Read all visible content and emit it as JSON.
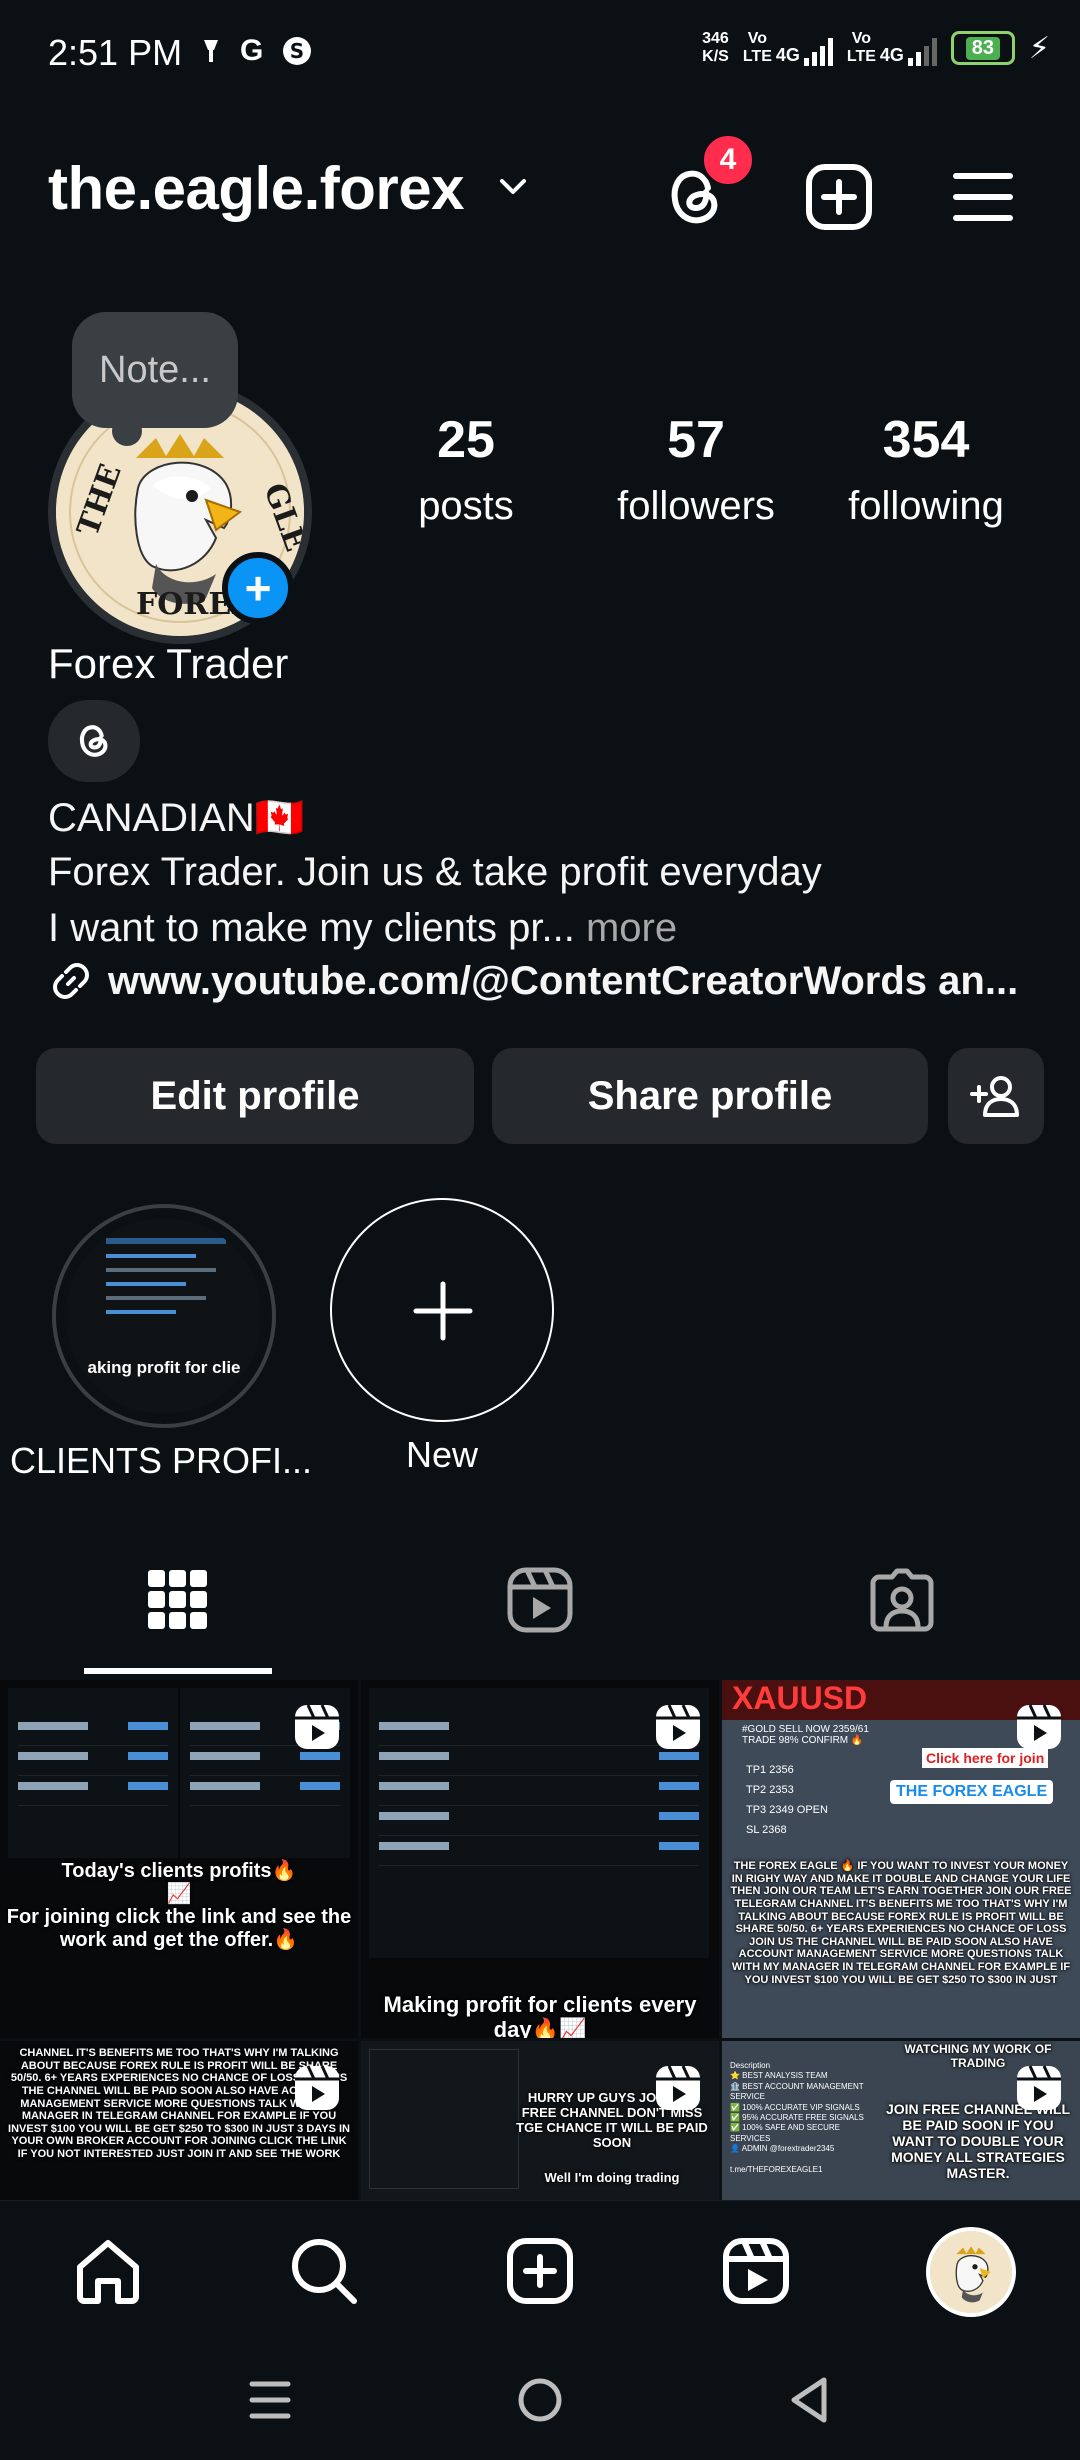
{
  "status_bar": {
    "time": "2:51 PM",
    "left_icons": [
      "signal-lamp-icon",
      "google-icon",
      "app-icon"
    ],
    "speed_value": "346",
    "speed_unit": "K/S",
    "sim1": "Vo\nLTE",
    "sim1_net": "4G",
    "sim2": "Vo\nLTE",
    "sim2_net": "4G",
    "battery": "83"
  },
  "header": {
    "username": "the.eagle.forex",
    "threads_badge": "4"
  },
  "profile": {
    "note_placeholder": "Note...",
    "display_name": "Forex Trader",
    "posts_count": "25",
    "posts_label": "posts",
    "followers_count": "57",
    "followers_label": "followers",
    "following_count": "354",
    "following_label": "following",
    "bio_line1": "CANADIAN🇨🇦",
    "bio_line2": "Forex Trader. Join us & take profit everyday",
    "bio_line3": "I want to make my clients pr...",
    "bio_more": " more",
    "link": "www.youtube.com/@ContentCreatorWords an..."
  },
  "actions": {
    "edit_profile": "Edit profile",
    "share_profile": "Share profile"
  },
  "highlights": [
    {
      "label": "CLIENTS PROFI...",
      "inner_text": "aking profit for clie"
    },
    {
      "label": "New"
    }
  ],
  "grid_posts": [
    {
      "caption": "Today's clients profits🔥\n📈\nFor joining click the link and see the work and get the offer.🔥"
    },
    {
      "caption": "Making profit for clients every day🔥📈"
    },
    {
      "caption": "THE FOREX EAGLE 🔥 IF YOU WANT TO INVEST YOUR MONEY IN RIGHY WAY AND MAKE IT DOUBLE AND CHANGE YOUR LIFE THEN JOIN OUR TEAM LET'S EARN TOGETHER JOIN OUR FREE TELEGRAM CHANNEL IT'S BENEFITS ME TOO THAT'S WHY I'M TALKING ABOUT BECAUSE FOREX RULE IS PROFIT WILL BE SHARE 50/50. 6+ YEARS EXPERIENCES NO CHANCE OF LOSS JOIN US THE CHANNEL WILL BE PAID SOON ALSO HAVE ACCOUNT MANAGEMENT SERVICE MORE QUESTIONS TALK WITH MY MANAGER IN TELEGRAM CHANNEL FOR EXAMPLE IF YOU INVEST $100 YOU WILL BE GET $250 TO $300 IN JUST",
      "header": "XAUUSD",
      "signal": "#GOLD SELL NOW 2359/61 TRADE 98% CONFIRM 🔥",
      "tp1": "TP1 2356",
      "tp2": "TP2 2353",
      "tp3": "TP3 2349 OPEN",
      "sl": "SL 2368",
      "click": "Click here for join",
      "brand": "THE FOREX EAGLE"
    },
    {
      "caption": "CHANNEL IT'S BENEFITS ME TOO THAT'S WHY I'M TALKING ABOUT BECAUSE FOREX RULE IS PROFIT WILL BE SHARE 50/50. 6+ YEARS EXPERIENCES NO CHANCE OF LOSS JOIN US THE CHANNEL WILL BE PAID SOON ALSO HAVE ACCOUNT MANAGEMENT SERVICE MORE QUESTIONS TALK WITH MY MANAGER IN TELEGRAM CHANNEL FOR EXAMPLE IF YOU INVEST $100 YOU WILL BE GET $250 TO $300 IN JUST 3 DAYS IN YOUR OWN BROKER ACCOUNT FOR JOINING CLICK THE LINK IF YOU NOT INTERESTED JUST JOIN IT AND SEE THE WORK"
    },
    {
      "caption": "HURRY UP GUYS JOIN IT'S FREE CHANNEL DON'T MISS TGE CHANCE IT WILL BE PAID SOON",
      "caption2": "Well I'm doing trading"
    },
    {
      "caption": "JOIN FREE CHANNEL WILL BE PAID SOON IF YOU WANT TO DOUBLE YOUR MONEY ALL STRATEGIES MASTER.",
      "top": "WATCHING MY WORK OF TRADING",
      "list": "Description\n⭐ BEST ANALYSIS TEAM\n🏦 BEST ACCOUNT MANAGEMENT SERVICE\n✅ 100% ACCURATE VIP SIGNALS\n✅ 95% ACCURATE FREE SIGNALS\n✅ 100% SAFE AND SECURE SERVICES\n👤 ADMIN @forextrader2345\n\nt.me/THEFOREXEAGLE1"
    }
  ],
  "colors": {
    "background": "#0b1014",
    "button": "#25292e",
    "accent_blue": "#0a95f6",
    "badge_red": "#ff2c4d"
  }
}
